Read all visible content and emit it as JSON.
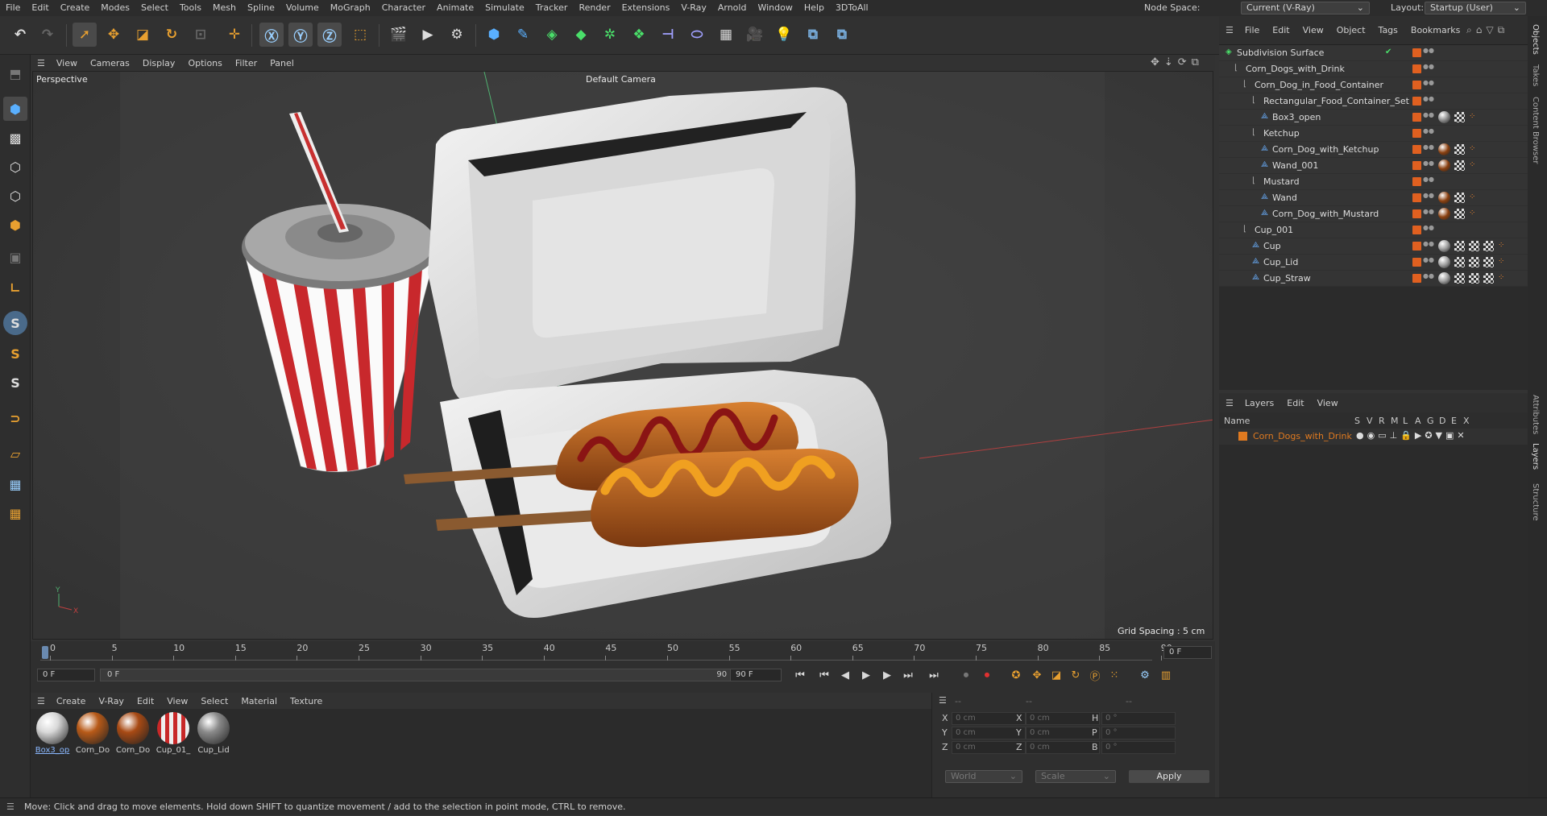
{
  "menubar": {
    "items": [
      "File",
      "Edit",
      "Create",
      "Modes",
      "Select",
      "Tools",
      "Mesh",
      "Spline",
      "Volume",
      "MoGraph",
      "Character",
      "Animate",
      "Simulate",
      "Tracker",
      "Render",
      "Extensions",
      "V-Ray",
      "Arnold",
      "Window",
      "Help",
      "3DToAll"
    ],
    "node_space_label": "Node Space:",
    "node_space_value": "Current (V-Ray)",
    "layout_label": "Layout:",
    "layout_value": "Startup (User)"
  },
  "viewport": {
    "menu": [
      "View",
      "Cameras",
      "Display",
      "Options",
      "Filter",
      "Panel"
    ],
    "view_name": "Perspective",
    "camera": "Default Camera",
    "grid_spacing": "Grid Spacing : 5 cm"
  },
  "timeline": {
    "ticks": [
      "0",
      "5",
      "10",
      "15",
      "20",
      "25",
      "30",
      "35",
      "40",
      "45",
      "50",
      "55",
      "60",
      "65",
      "70",
      "75",
      "80",
      "85",
      "90"
    ],
    "current_frame": "0 F",
    "start_frame": "0 F",
    "range_start": "0 F",
    "range_end": "90 F",
    "end_frame": "90 F"
  },
  "materials": {
    "menu": [
      "Create",
      "V-Ray",
      "Edit",
      "View",
      "Select",
      "Material",
      "Texture"
    ],
    "items": [
      {
        "name": "Box3_op",
        "color": "#d8d8d8"
      },
      {
        "name": "Corn_Do",
        "color": "#b85a18"
      },
      {
        "name": "Corn_Do",
        "color": "#a84a14"
      },
      {
        "name": "Cup_01_",
        "color": "#e6e6e6"
      },
      {
        "name": "Cup_Lid",
        "color": "#8a8a8a"
      }
    ]
  },
  "coords": {
    "header1": "--",
    "header2": "--",
    "header3": "--",
    "rows": [
      {
        "a": "X",
        "av": "0 cm",
        "b": "X",
        "bv": "0 cm",
        "c": "H",
        "cv": "0 °"
      },
      {
        "a": "Y",
        "av": "0 cm",
        "b": "Y",
        "bv": "0 cm",
        "c": "P",
        "cv": "0 °"
      },
      {
        "a": "Z",
        "av": "0 cm",
        "b": "Z",
        "bv": "0 cm",
        "c": "B",
        "cv": "0 °"
      }
    ],
    "world": "World",
    "scale": "Scale",
    "apply": "Apply"
  },
  "objects": {
    "menu": [
      "File",
      "Edit",
      "View",
      "Object",
      "Tags",
      "Bookmarks"
    ],
    "rows": [
      {
        "name": "Subdivision Surface",
        "indent": 0,
        "tags": "check"
      },
      {
        "name": "Corn_Dogs_with_Drink",
        "indent": 1,
        "tags": ""
      },
      {
        "name": "Corn_Dog_in_Food_Container",
        "indent": 2,
        "tags": ""
      },
      {
        "name": "Rectangular_Food_Container_Set",
        "indent": 3,
        "tags": ""
      },
      {
        "name": "Box3_open",
        "indent": 4,
        "tags": "grey"
      },
      {
        "name": "Ketchup",
        "indent": 3,
        "tags": ""
      },
      {
        "name": "Corn_Dog_with_Ketchup",
        "indent": 4,
        "tags": "brown"
      },
      {
        "name": "Wand_001",
        "indent": 4,
        "tags": "brown"
      },
      {
        "name": "Mustard",
        "indent": 3,
        "tags": ""
      },
      {
        "name": "Wand",
        "indent": 4,
        "tags": "brown"
      },
      {
        "name": "Corn_Dog_with_Mustard",
        "indent": 4,
        "tags": "brown"
      },
      {
        "name": "Cup_001",
        "indent": 2,
        "tags": ""
      },
      {
        "name": "Cup",
        "indent": 3,
        "tags": "cup"
      },
      {
        "name": "Cup_Lid",
        "indent": 3,
        "tags": "cup"
      },
      {
        "name": "Cup_Straw",
        "indent": 3,
        "tags": "cup"
      }
    ]
  },
  "layers": {
    "menu": [
      "Layers",
      "Edit",
      "View"
    ],
    "name_header": "Name",
    "col_headers": [
      "S",
      "V",
      "R",
      "M",
      "L",
      "A",
      "G",
      "D",
      "E",
      "X"
    ],
    "items": [
      {
        "name": "Corn_Dogs_with_Drink",
        "color": "#e07a20"
      }
    ]
  },
  "side_tabs": [
    "Objects",
    "Takes",
    "Content Browser",
    "Attributes",
    "Layers",
    "Structure"
  ],
  "status": "Move: Click and drag to move elements. Hold down SHIFT to quantize movement / add to the selection in point mode, CTRL to remove."
}
